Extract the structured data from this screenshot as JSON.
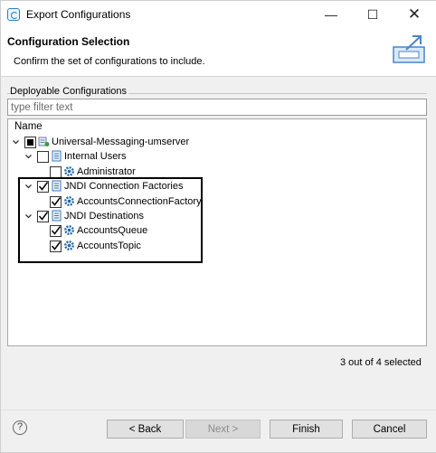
{
  "window": {
    "title": "Export Configurations"
  },
  "header": {
    "title": "Configuration Selection",
    "description": "Confirm the set of configurations to include."
  },
  "group": {
    "label": "Deployable Configurations",
    "filter_placeholder": "type filter text",
    "column_header": "Name"
  },
  "tree": [
    {
      "label": "Universal-Messaging-umserver",
      "level": 0,
      "expanded": true,
      "check": "partial",
      "icon": "server-icon"
    },
    {
      "label": "Internal Users",
      "level": 1,
      "expanded": true,
      "check": "unchecked",
      "icon": "folder-doc-icon"
    },
    {
      "label": "Administrator",
      "level": 2,
      "expanded": null,
      "check": "unchecked",
      "icon": "gear-icon"
    },
    {
      "label": "JNDI Connection Factories",
      "level": 1,
      "expanded": true,
      "check": "checked",
      "icon": "folder-doc-icon"
    },
    {
      "label": "AccountsConnectionFactory",
      "level": 2,
      "expanded": null,
      "check": "checked",
      "icon": "gear-icon"
    },
    {
      "label": "JNDI Destinations",
      "level": 1,
      "expanded": true,
      "check": "checked",
      "icon": "folder-doc-icon"
    },
    {
      "label": "AccountsQueue",
      "level": 2,
      "expanded": null,
      "check": "checked",
      "icon": "gear-icon"
    },
    {
      "label": "AccountsTopic",
      "level": 2,
      "expanded": null,
      "check": "checked",
      "icon": "gear-icon"
    }
  ],
  "status": "3 out of 4 selected",
  "buttons": {
    "back": "< Back",
    "next": "Next >",
    "finish": "Finish",
    "cancel": "Cancel"
  },
  "colors": {
    "accent": "#2a7fc8",
    "icon_blue": "#3a78b5",
    "gear_blue": "#1f66a8"
  }
}
